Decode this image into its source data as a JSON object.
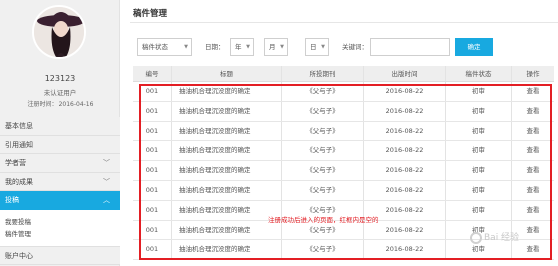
{
  "user": {
    "name": "123123",
    "status": "未认证用户",
    "reg_label": "注册时间：",
    "reg_date": "2016-04-16"
  },
  "sidebar": {
    "items": [
      {
        "label": "基本信息"
      },
      {
        "label": "引用通知"
      },
      {
        "label": "学者营",
        "chevron": "chevron-down-icon"
      },
      {
        "label": "我的成果",
        "chevron": "chevron-down-icon"
      },
      {
        "label": "投稿",
        "chevron": "chevron-up-icon",
        "active": true
      }
    ],
    "submenu": [
      "我要投稿",
      "稿件管理"
    ],
    "bottom_item": "账户中心"
  },
  "page": {
    "title": "稿件管理"
  },
  "filters": {
    "status_select": "稿件状态",
    "date_label": "日期：",
    "year_select": "年",
    "month_select": "月",
    "day_select": "日",
    "keyword_label": "关键词：",
    "keyword_value": "",
    "confirm_label": "确定"
  },
  "table": {
    "columns": [
      "编号",
      "标题",
      "所投期刊",
      "出版时间",
      "稿件状态",
      "操作"
    ],
    "rows": [
      [
        "001",
        "抽油机合理沉没度的确定",
        "《父与子》",
        "2016-08-22",
        "初审",
        "查看"
      ],
      [
        "001",
        "抽油机合理沉没度的确定",
        "《父与子》",
        "2016-08-22",
        "初审",
        "查看"
      ],
      [
        "001",
        "抽油机合理沉没度的确定",
        "《父与子》",
        "2016-08-22",
        "初审",
        "查看"
      ],
      [
        "001",
        "抽油机合理沉没度的确定",
        "《父与子》",
        "2016-08-22",
        "初审",
        "查看"
      ],
      [
        "001",
        "抽油机合理沉没度的确定",
        "《父与子》",
        "2016-08-22",
        "初审",
        "查看"
      ],
      [
        "001",
        "抽油机合理沉没度的确定",
        "《父与子》",
        "2016-08-22",
        "初审",
        "查看"
      ],
      [
        "001",
        "抽油机合理沉没度的确定",
        "《父与子》",
        "2016-08-22",
        "初审",
        "查看"
      ],
      [
        "001",
        "抽油机合理沉没度的确定",
        "《父与子》",
        "2016-08-22",
        "初审",
        "查看"
      ],
      [
        "001",
        "抽油机合理沉没度的确定",
        "《父与子》",
        "2016-08-22",
        "初审",
        "查看"
      ]
    ]
  },
  "annotation": "注册成功后进入的页面，红框内是空的",
  "watermark": "Bai 经验",
  "colors": {
    "accent": "#18a9e0",
    "annotation_red": "#e31e24",
    "sidebar_bg": "#f0f0f0"
  }
}
